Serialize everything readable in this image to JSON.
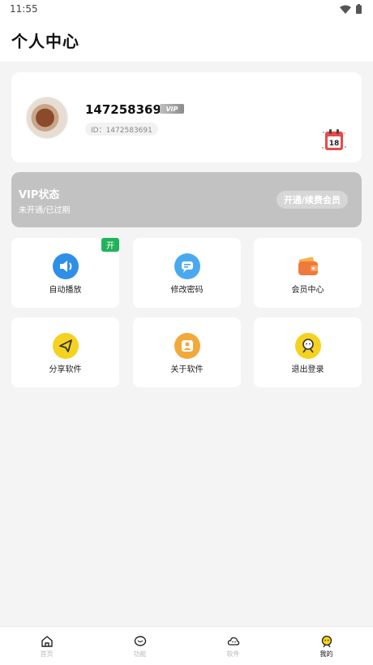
{
  "status_bar": {
    "time": "11:55"
  },
  "header": {
    "title": "个人中心"
  },
  "profile": {
    "name": "1472583691",
    "vip_badge": "VIP",
    "id_text": "ID：1472583691"
  },
  "vip": {
    "title": "VIP状态",
    "subtitle": "未开通/已过期",
    "button": "开通/续费会员"
  },
  "calendar": {
    "day": "18"
  },
  "tiles": [
    {
      "label": "自动播放",
      "icon": "speaker-icon",
      "color": "#2f8ee8",
      "badge": "开"
    },
    {
      "label": "修改密码",
      "icon": "chat-lock-icon",
      "color": "#4aa9ee"
    },
    {
      "label": "会员中心",
      "icon": "wallet-icon",
      "color": "#f07a3b"
    },
    {
      "label": "分享软件",
      "icon": "send-icon",
      "color": "#f5d21f"
    },
    {
      "label": "关于软件",
      "icon": "user-card-icon",
      "color": "#f2a93b"
    },
    {
      "label": "退出登录",
      "icon": "emoji-icon",
      "color": "#f5d21f"
    }
  ],
  "bottom_nav": [
    {
      "label": "首页",
      "icon": "home-icon",
      "active": false
    },
    {
      "label": "功能",
      "icon": "chat-icon",
      "active": false
    },
    {
      "label": "软件",
      "icon": "cloud-icon",
      "active": false
    },
    {
      "label": "我的",
      "icon": "mine-icon",
      "active": true
    }
  ]
}
